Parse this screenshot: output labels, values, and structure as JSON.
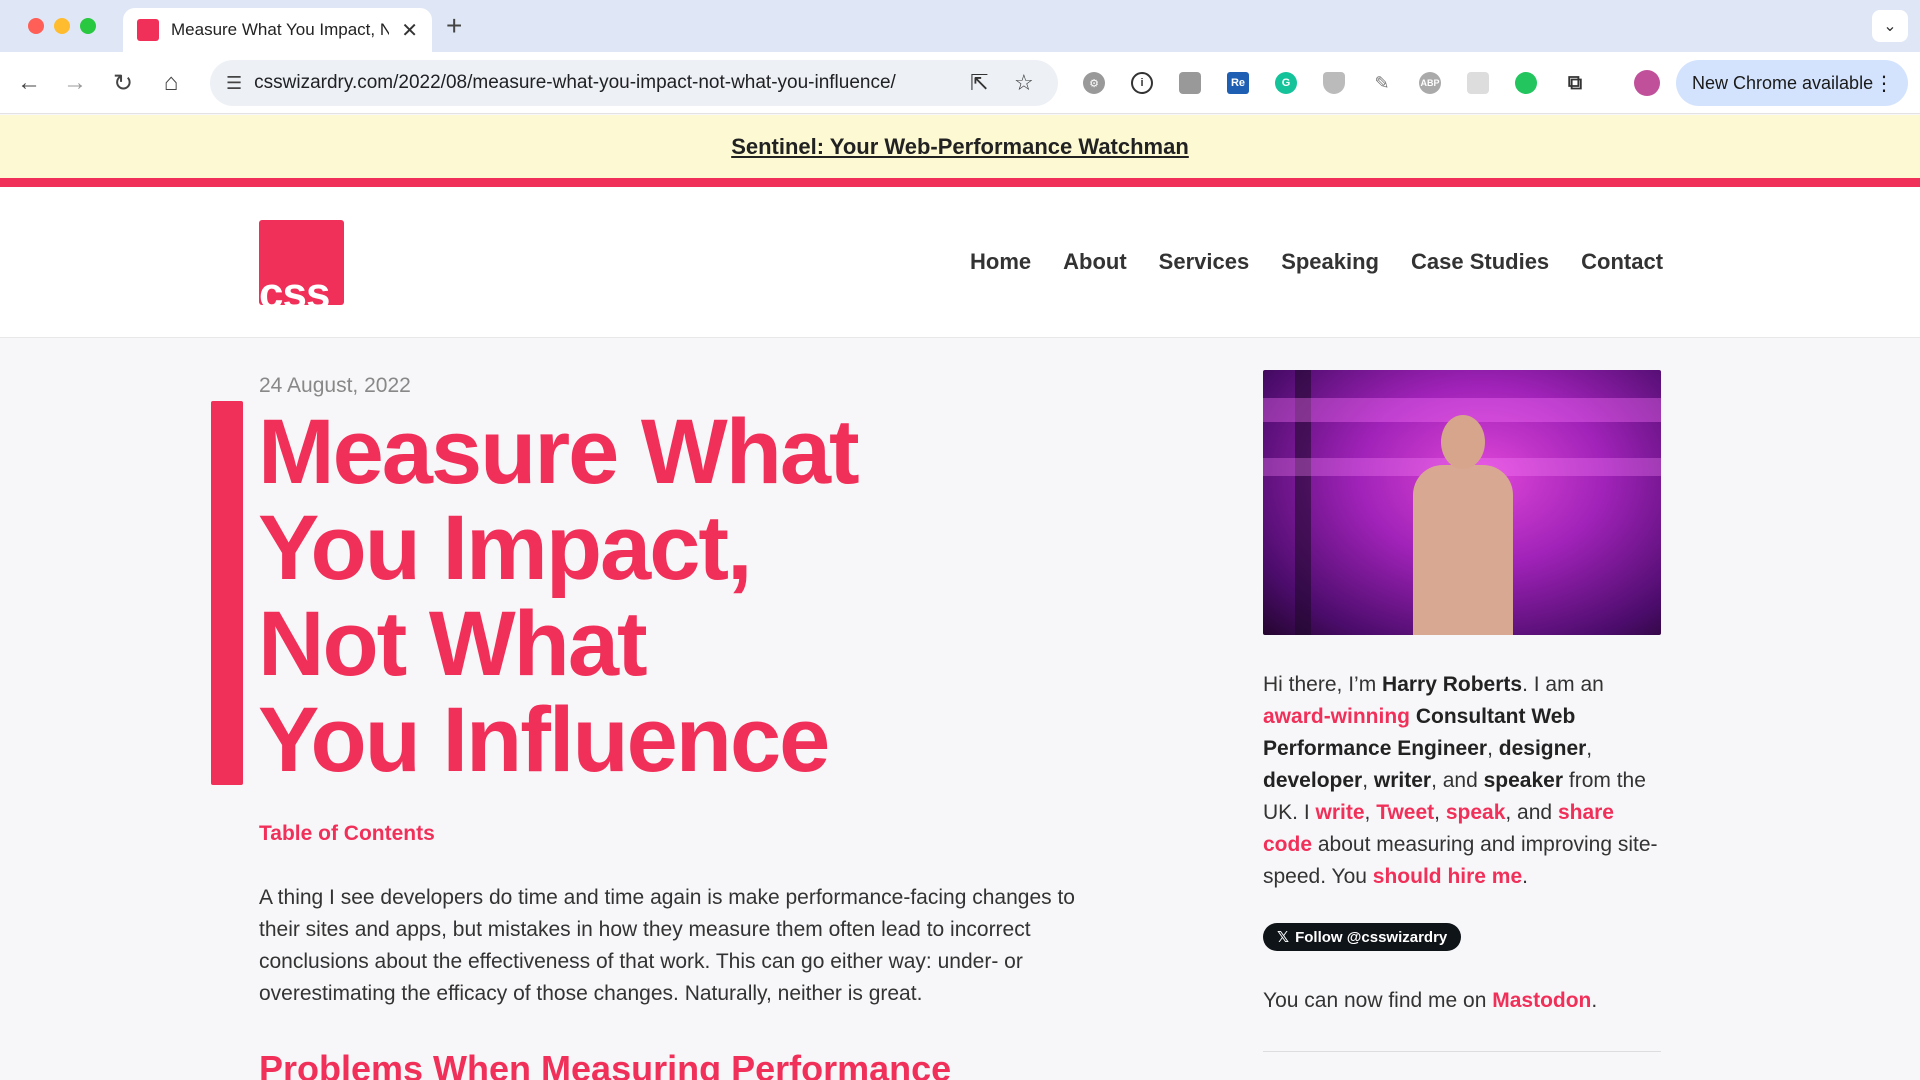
{
  "browser": {
    "tab_title": "Measure What You Impact, Not What You Influence",
    "new_tab_glyph": "+",
    "url": "csswizardry.com/2022/08/measure-what-you-impact-not-what-you-influence/",
    "update_label": "New Chrome available",
    "extensions": [
      "gear-icon",
      "info-icon",
      "camera-icon",
      "re-icon",
      "grammarly-icon",
      "shield-icon",
      "pin-icon",
      "abp-icon",
      "puzzle-grid-icon",
      "green-dot-icon",
      "extensions-icon"
    ],
    "extension_labels": {
      "re": "Re",
      "abp": "ABP"
    }
  },
  "banner": {
    "link": "Sentinel: Your Web-Performance Watchman"
  },
  "header": {
    "logo_text": "css",
    "nav": [
      "Home",
      "About",
      "Services",
      "Speaking",
      "Case Studies",
      "Contact"
    ]
  },
  "article": {
    "date": "24 August, 2022",
    "title_lines": [
      "Measure What",
      "You Impact,",
      "Not What",
      "You Influence"
    ],
    "toc": "Table of Contents",
    "intro": "A thing I see developers do time and time again is make performance-facing changes to their sites and apps, but mistakes in how they measure them often lead to incorrect conclusions about the effectiveness of that work. This can go either way: under- or overestimating the efficacy of those changes. Naturally, neither is great.",
    "subhead": "Problems When Measuring Performance"
  },
  "aside": {
    "bio": {
      "p1": "Hi there, I’m ",
      "name": "Harry Roberts",
      "p2": ". I am an ",
      "award": "award-winning",
      "p3": " ",
      "role1": "Consultant Web Performance Engineer",
      "c1": ", ",
      "role2": "designer",
      "c2": ", ",
      "role3": "developer",
      "c3": ", ",
      "role4": "writer",
      "c4": ", and ",
      "role5": "speaker",
      "p4": " from the UK. I ",
      "write": "write",
      "c5": ", ",
      "tweet": "Tweet",
      "c6": ", ",
      "speak": "speak",
      "c7": ", and ",
      "share": "share code",
      "p5": " about measuring and improving site-speed. You ",
      "hire": "should hire me",
      "p6": "."
    },
    "follow_label": "Follow @csswizardry",
    "mastodon_pre": "You can now find me on ",
    "mastodon_link": "Mastodon",
    "mastodon_post": "."
  },
  "colors": {
    "accent": "#f1305a",
    "banner_bg": "#fdfad3",
    "page_bg": "#f7f7f9"
  }
}
